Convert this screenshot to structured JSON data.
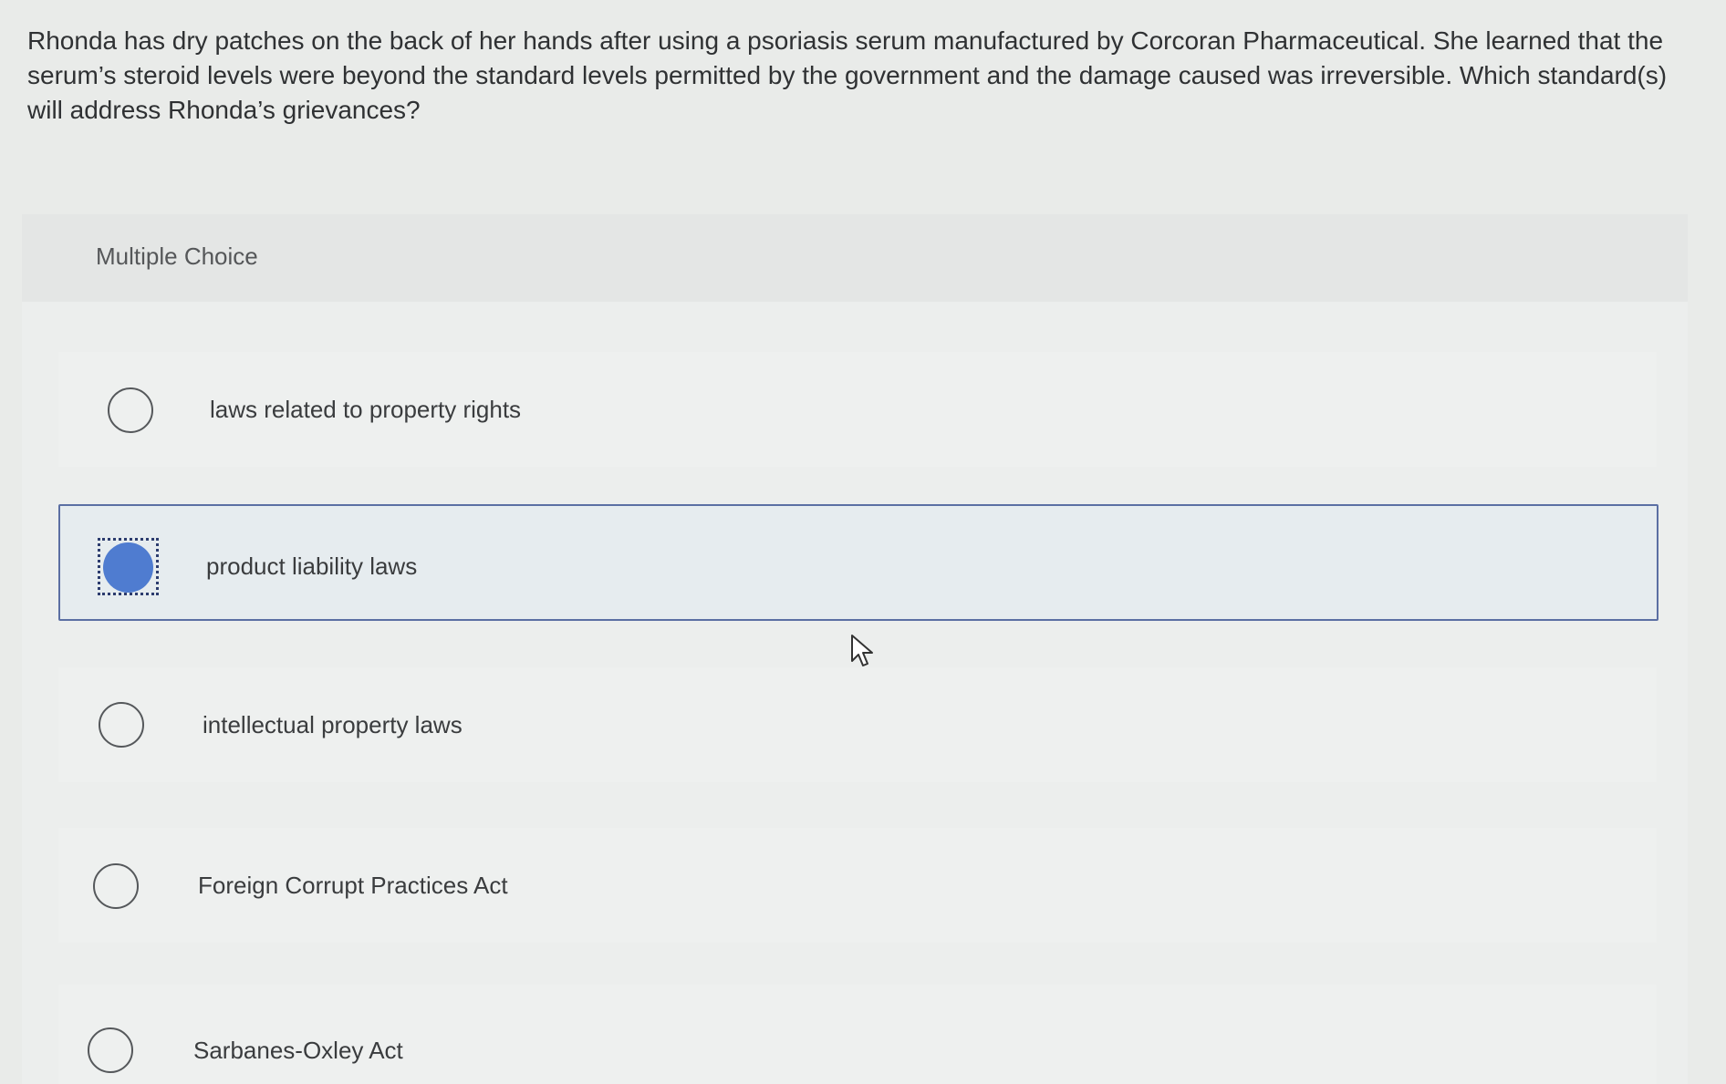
{
  "question": {
    "text": "Rhonda has dry patches on the back of her hands after using a psoriasis serum manufactured by Corcoran Pharmaceutical. She learned that the serum’s steroid levels were beyond the standard levels permitted by the government and the damage caused was irreversible. Which standard(s) will address Rhonda’s grievances?"
  },
  "multiple_choice": {
    "label": "Multiple Choice",
    "options": [
      {
        "label": "laws related to property rights",
        "selected": false
      },
      {
        "label": "product liability laws",
        "selected": true
      },
      {
        "label": "intellectual property laws",
        "selected": false
      },
      {
        "label": "Foreign Corrupt Practices Act",
        "selected": false
      },
      {
        "label": "Sarbanes-Oxley Act",
        "selected": false
      }
    ]
  },
  "colors": {
    "selected_fill": "#4f7cd0",
    "selected_border": "#5b6fa3"
  },
  "icons": {
    "cursor": "mouse-pointer-icon"
  }
}
